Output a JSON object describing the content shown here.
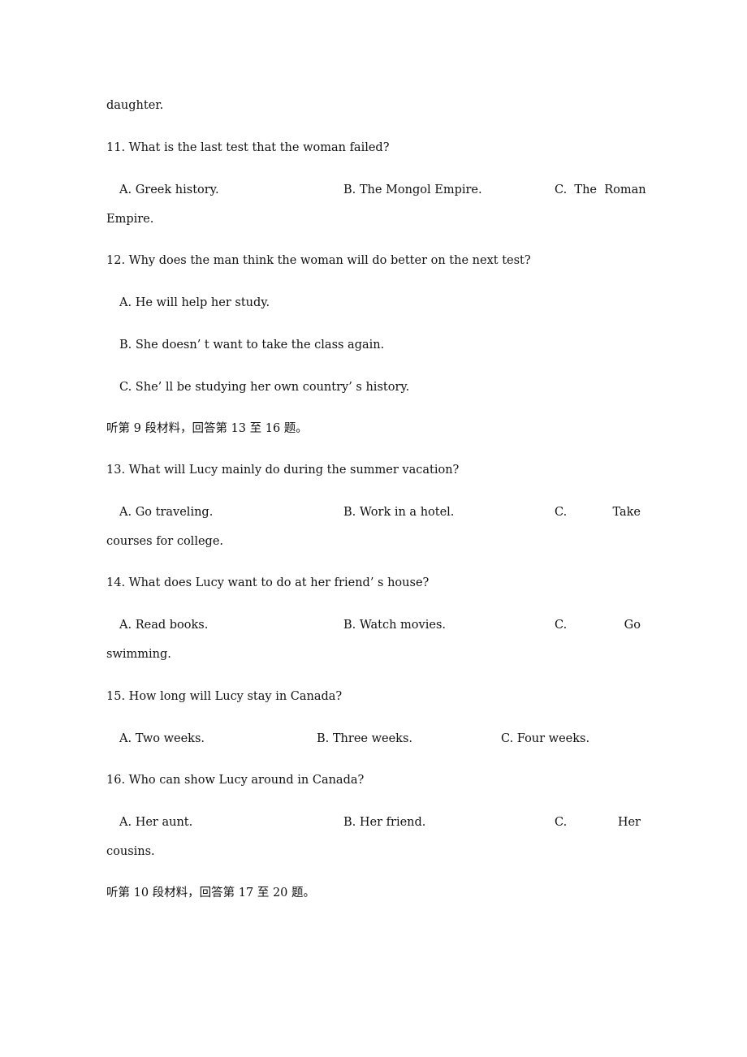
{
  "document": {
    "continuation": "daughter.",
    "questions": [
      {
        "number": "11.",
        "text": "What is the last test that the woman failed?",
        "options": [
          {
            "label": "A.",
            "text": "Greek history."
          },
          {
            "label": "B.",
            "text": "The Mongol Empire."
          },
          {
            "label": "C.",
            "text": "The  Roman",
            "wrap": "Empire."
          }
        ]
      },
      {
        "number": "12.",
        "text": "Why does the man think the woman will do better on the next test?",
        "options": [
          {
            "label": "A.",
            "text": "He will help her study."
          },
          {
            "label": "B.",
            "text": "She doesn’ t want to take the class again."
          },
          {
            "label": "C.",
            "text": "She’ ll be studying her own country’ s history."
          }
        ]
      },
      {
        "number": "13.",
        "text": "What will Lucy mainly do during the summer vacation?",
        "options": [
          {
            "label": "A.",
            "text": "Go traveling."
          },
          {
            "label": "B.",
            "text": "Work in a hotel."
          },
          {
            "label": "C.",
            "text": "Take",
            "wrap": "courses for college."
          }
        ]
      },
      {
        "number": "14.",
        "text": "What does Lucy want to do at her friend’ s house?",
        "options": [
          {
            "label": "A.",
            "text": "Read books."
          },
          {
            "label": "B.",
            "text": "Watch movies."
          },
          {
            "label": "C.",
            "text": "Go",
            "wrap": "swimming."
          }
        ]
      },
      {
        "number": "15.",
        "text": "How long will Lucy stay in Canada?",
        "options": [
          {
            "label": "A.",
            "text": "Two weeks."
          },
          {
            "label": "B.",
            "text": "Three weeks."
          },
          {
            "label": "C.",
            "text": "Four weeks."
          }
        ]
      },
      {
        "number": "16.",
        "text": "Who can show Lucy around in Canada?",
        "options": [
          {
            "label": "A.",
            "text": "Her aunt."
          },
          {
            "label": "B.",
            "text": "Her friend."
          },
          {
            "label": "C.",
            "text": "Her",
            "wrap": "cousins."
          }
        ]
      }
    ],
    "section_headers": {
      "s9": "听第 9 段材料，回答第 13 至 16 题。",
      "s10": "听第 10 段材料，回答第 17 至 20 题。"
    }
  }
}
